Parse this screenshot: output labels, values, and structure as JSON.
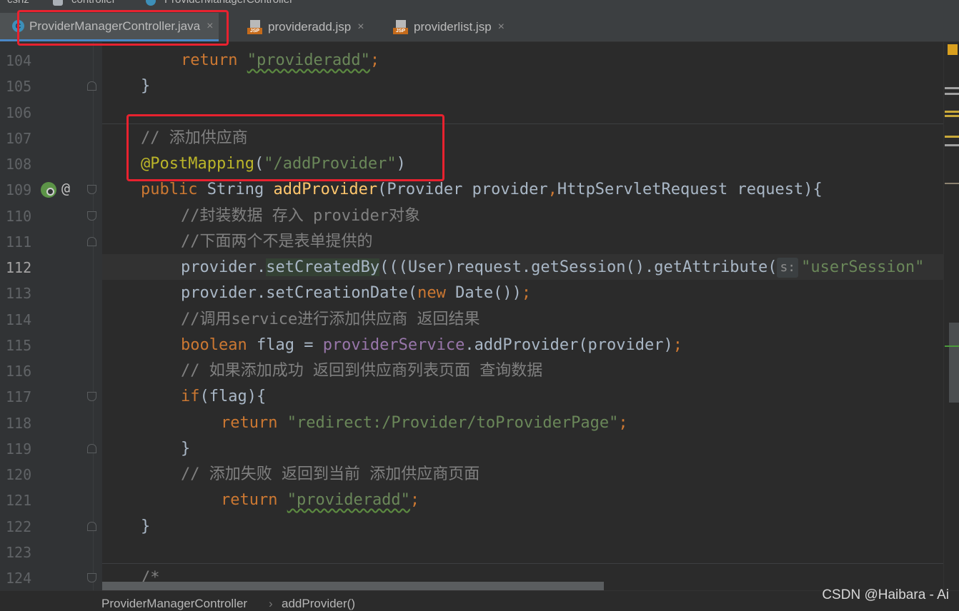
{
  "breadcrumb_top": [
    "cshz",
    "controller",
    "ProviderManagerController"
  ],
  "tabs": [
    {
      "label": "ProviderManagerController.java",
      "icon": "java-class-icon",
      "active": true
    },
    {
      "label": "provideradd.jsp",
      "icon": "jsp-file-icon",
      "active": false
    },
    {
      "label": "providerlist.jsp",
      "icon": "jsp-file-icon",
      "active": false
    }
  ],
  "jsp_badge": "JSP",
  "class_badge": "C",
  "close_glyph": "×",
  "gutter": {
    "line_numbers": [
      "104",
      "105",
      "106",
      "107",
      "108",
      "109",
      "110",
      "111",
      "112",
      "113",
      "114",
      "115",
      "116",
      "117",
      "118",
      "119",
      "120",
      "121",
      "122",
      "123",
      "124"
    ],
    "current_line": "112",
    "at_glyph": "@"
  },
  "code": {
    "l104": {
      "kw": "return",
      "str": "\"provideradd\"",
      "end": ";"
    },
    "l105": "}",
    "l107": "// 添加供应商",
    "l108": {
      "ann": "@PostMapping",
      "open": "(",
      "str": "\"/addProvider\"",
      "close": ")"
    },
    "l109": {
      "kw": "public",
      "type": " String ",
      "fn": "addProvider",
      "rest": "(Provider provider",
      "comma": ",",
      "rest2": "HttpServletRequest request){"
    },
    "l110": "//封装数据 存入 provider对象",
    "l111": "//下面两个不是表单提供的",
    "l112": {
      "a": "provider.",
      "m": "setCreatedBy",
      "b": "(((User)request.getSession().getAttribute(",
      "hint": "s:",
      "str": "\"userSession\""
    },
    "l113": {
      "a": "provider.setCreationDate(",
      "kw": "new",
      "b": " Date())",
      "end": ";"
    },
    "l114": "//调用service进行添加供应商 返回结果",
    "l115": {
      "kw": "boolean",
      "a": " flag = ",
      "fld": "providerService",
      "b": ".addProvider(provider)",
      "end": ";"
    },
    "l116": "// 如果添加成功 返回到供应商列表页面 查询数据",
    "l117": {
      "kw": "if",
      "b": "(flag){"
    },
    "l118": {
      "kw": "return",
      "str": "\"redirect:/Provider/toProviderPage\"",
      "end": ";"
    },
    "l119": "}",
    "l120": "// 添加失败 返回到当前 添加供应商页面",
    "l121": {
      "kw": "return",
      "str": "\"provideradd\"",
      "end": ";"
    },
    "l122": "}",
    "l124": "/*"
  },
  "status_bar": {
    "class_name": "ProviderManagerController",
    "method": "addProvider()",
    "separator": "›"
  },
  "watermark": "CSDN @Haibara - Ai",
  "colors": {
    "keyword": "#cc7832",
    "string": "#6a8759",
    "comment": "#808080",
    "annotation": "#bbb529",
    "method_decl": "#ffc66d",
    "field": "#9876aa",
    "highlight_box": "#e8222f"
  }
}
